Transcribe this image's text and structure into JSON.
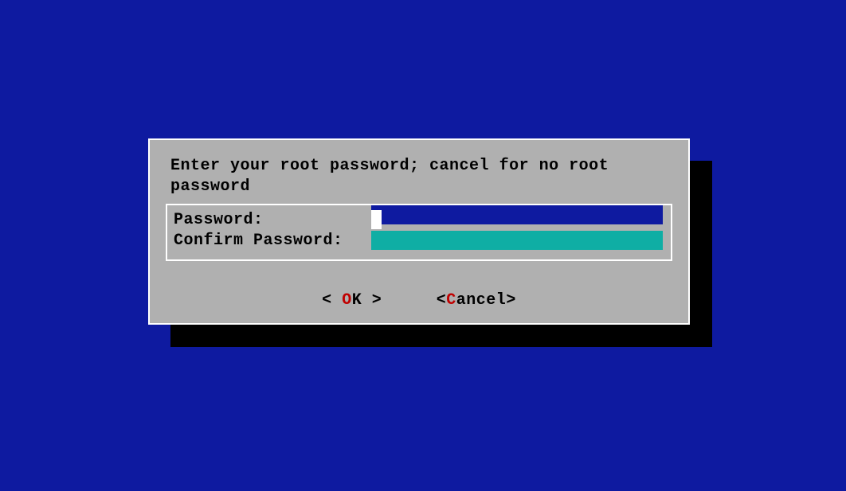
{
  "dialog": {
    "prompt": "Enter your root password; cancel for no root password",
    "fields": {
      "password": {
        "label": "Password:",
        "value": ""
      },
      "confirm": {
        "label": "Confirm Password:",
        "value": ""
      }
    },
    "buttons": {
      "ok": {
        "open": "<",
        "space1": "  ",
        "key": "O",
        "rest": "K",
        "space2": "  ",
        "close": ">"
      },
      "cancel": {
        "open": "<",
        "key": "C",
        "rest": "ancel",
        "close": ">"
      },
      "selected": "ok"
    }
  },
  "colors": {
    "background": "#0e1aa0",
    "dialog_bg": "#b0b0b0",
    "password_input_bg": "#0e1aa0",
    "confirm_input_bg": "#0faea4",
    "hotkey": "#c00000"
  }
}
